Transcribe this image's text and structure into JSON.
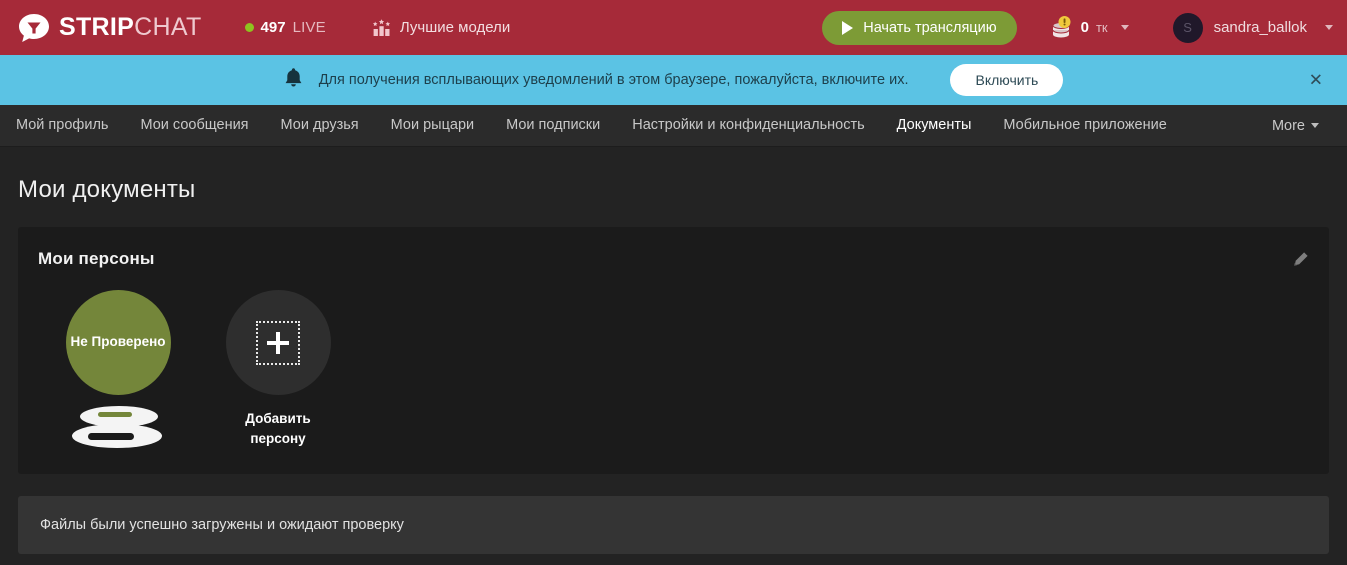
{
  "header": {
    "logo": {
      "part1": "STRIP",
      "part2": "CHAT",
      "icon": "stripchat-bubble-logo"
    },
    "live": {
      "count": "497",
      "label": "LIVE",
      "dot_color": "#8ec31f"
    },
    "top_models": {
      "label": "Лучшие модели",
      "icon": "podium-star-icon"
    },
    "broadcast_button": {
      "label": "Начать трансляцию",
      "icon": "play-icon",
      "color": "#7d9b36"
    },
    "tokens": {
      "amount": "0",
      "unit": "тк",
      "icon": "coins-icon",
      "badge_icon": "alert-exclamation-icon"
    },
    "user": {
      "avatar_initial": "S",
      "name": "sandra_ballok"
    },
    "background_color": "#a62a39"
  },
  "notification": {
    "icon": "bell-icon",
    "text": "Для получения всплывающих уведомлений в этом браузере, пожалуйста, включите их.",
    "button_label": "Включить",
    "close_label": "✕",
    "background_color": "#5bc3e4"
  },
  "nav": {
    "items": [
      {
        "label": "Мой профиль",
        "active": false
      },
      {
        "label": "Мои сообщения",
        "active": false
      },
      {
        "label": "Мои друзья",
        "active": false
      },
      {
        "label": "Мои рыцари",
        "active": false
      },
      {
        "label": "Мои подписки",
        "active": false
      },
      {
        "label": "Настройки и конфиденциальность",
        "active": false
      },
      {
        "label": "Документы",
        "active": true
      },
      {
        "label": "Мобильное приложение",
        "active": false
      }
    ],
    "more_label": "More"
  },
  "main": {
    "page_title": "Мои документы",
    "card": {
      "title": "Мои персоны",
      "edit_icon": "pencil-edit-icon",
      "personas": [
        {
          "type": "existing",
          "status_label": "Не Проверено",
          "name_redacted": true,
          "circle_color": "#74863a"
        },
        {
          "type": "add",
          "label": "Добавить персону",
          "icon": "plus-icon",
          "circle_color": "#2e2e2e"
        }
      ]
    },
    "alert": {
      "text": "Файлы были успешно загружены и ожидают проверку",
      "background_color": "#343434"
    }
  },
  "page": {
    "background_color": "#232323",
    "card_background_color": "#1b1b1b"
  }
}
